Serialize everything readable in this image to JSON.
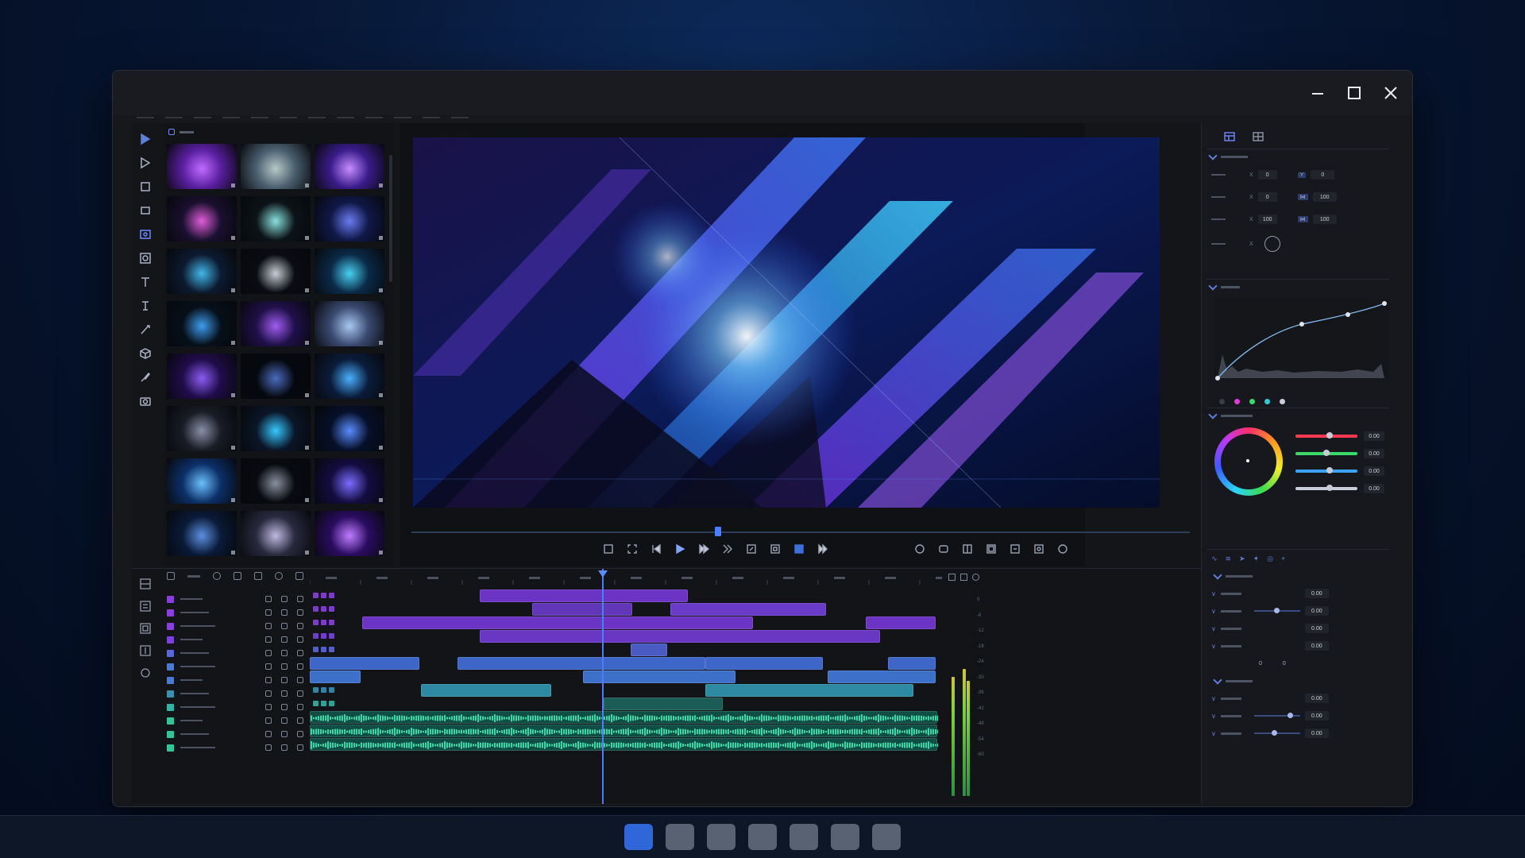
{
  "window": {
    "controls": [
      "minimize-icon",
      "maximize-icon",
      "close-icon"
    ]
  },
  "toolbar": {
    "tools": [
      "select-icon",
      "arrow-icon",
      "crop-icon",
      "rectangle-icon",
      "image-icon",
      "mask-icon",
      "text-icon",
      "text-alt-icon",
      "pen-icon",
      "shape-3d-icon",
      "brush-icon",
      "camera-icon"
    ]
  },
  "media_bin": {
    "thumbnail_count": 24
  },
  "inspector": {
    "transform_rows": [
      {
        "x": "0",
        "y": "0"
      },
      {
        "x": "0",
        "y": "100"
      },
      {
        "x": "100",
        "y": "100"
      }
    ],
    "color_values": [
      "0.00",
      "0.00",
      "0.00",
      "0.00"
    ],
    "color_slider_colors": [
      "#ff3a4e",
      "#3ad96a",
      "#3aa2ff",
      "#c9cedb"
    ],
    "dot_colors": [
      "#3a3d45",
      "#e03bd8",
      "#3ad96a",
      "#36c8d2",
      "#c9cedb"
    ],
    "audio_values": [
      "0.00",
      "0.00",
      "0.00",
      "0.00",
      "0.00",
      "0.00",
      "0.00"
    ],
    "pan_values": [
      "0",
      "0"
    ]
  },
  "timeline": {
    "track_colors": [
      "#8b3fd6",
      "#8b3fd6",
      "#8b3fd6",
      "#7d42d8",
      "#5a68d6",
      "#4a7ad6",
      "#4a7ad6",
      "#3b8fb0",
      "#39b0a6",
      "#38c29a",
      "#36c497",
      "#36c497"
    ],
    "meter_labels": [
      "0",
      "-6",
      "-12",
      "-18",
      "-24",
      "-30",
      "-36",
      "-42",
      "-48",
      "-54",
      "-60"
    ]
  },
  "taskbar": {
    "items": 7,
    "active_index": 0
  }
}
